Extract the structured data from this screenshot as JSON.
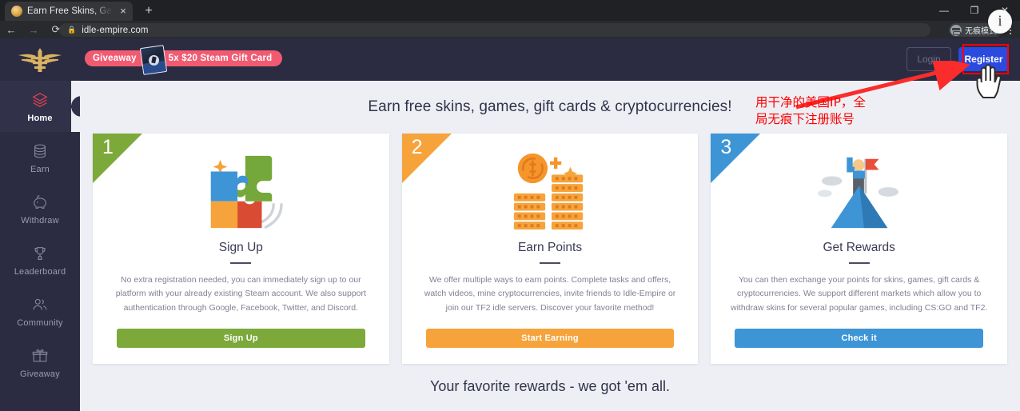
{
  "browser": {
    "tab": {
      "title": "Earn Free Skins, Games, Gift C",
      "favicon": "eagle-favicon",
      "close": "×"
    },
    "new_tab": "+",
    "window_controls": {
      "minimize": "—",
      "maximize": "❐",
      "close": "✕"
    },
    "nav": {
      "back": "←",
      "forward": "→",
      "reload": "⟳"
    },
    "omnibox": {
      "lock_icon": "lock-icon",
      "url": "idle-empire.com"
    },
    "bookmark_star": "☆",
    "incognito_label": "无痕模式",
    "menu": "kebab-menu-icon",
    "info_bubble": "i"
  },
  "sidebar": {
    "logo": "idle-empire-eagle-logo",
    "items": [
      {
        "label": "Home",
        "icon": "layers-icon",
        "active": true
      },
      {
        "label": "Earn",
        "icon": "coins-icon",
        "active": false
      },
      {
        "label": "Withdraw",
        "icon": "piggy-bank-icon",
        "active": false
      },
      {
        "label": "Leaderboard",
        "icon": "trophy-icon",
        "active": false
      },
      {
        "label": "Community",
        "icon": "people-icon",
        "active": false
      },
      {
        "label": "Giveaway",
        "icon": "gift-icon",
        "active": false
      }
    ]
  },
  "navbar": {
    "giveaway_badge": {
      "label": "Giveaway",
      "prize": "5x $20 Steam Gift Card",
      "image": "steam-gift-card-icon"
    },
    "login_label": "Login",
    "register_label": "Register"
  },
  "content": {
    "hero_title": "Earn free skins, games, gift cards & cryptocurrencies!",
    "bottom_title": "Your favorite rewards - we got 'em all.",
    "cards": [
      {
        "number": "1",
        "title": "Sign Up",
        "description": "No extra registration needed, you can immediately sign up to our platform with your already existing Steam account. We also support authentication through Google, Facebook, Twitter, and Discord.",
        "button": "Sign Up",
        "color": "#7ca93a",
        "art": "puzzle-pieces-illustration"
      },
      {
        "number": "2",
        "title": "Earn Points",
        "description": "We offer multiple ways to earn points. Complete tasks and offers, watch videos, mine cryptocurrencies, invite friends to Idle-Empire or join our TF2 idle servers. Discover your favorite method!",
        "button": "Start Earning",
        "color": "#f6a33b",
        "art": "coin-stacks-illustration"
      },
      {
        "number": "3",
        "title": "Get Rewards",
        "description": "You can then exchange your points for skins, games, gift cards & cryptocurrencies. We support different markets which allow you to withdraw skins for several popular games, including CS:GO and TF2.",
        "button": "Check it",
        "color": "#3d95d6",
        "art": "mountain-flag-illustration"
      }
    ]
  },
  "annotation": {
    "text_line1": "用干净的美国IP，全",
    "text_line2": "局无痕下注册账号",
    "arrow": "red-arrow-pointing-to-register",
    "highlight_box": "red-highlight-around-register",
    "cursor": "hand-cursor"
  },
  "colors": {
    "sidebar_bg": "#2b2c41",
    "content_bg": "#edeff4",
    "register_blue": "#2b4ae0",
    "annotation_red": "#ff0000",
    "giveaway_pink": "#f15b72"
  }
}
